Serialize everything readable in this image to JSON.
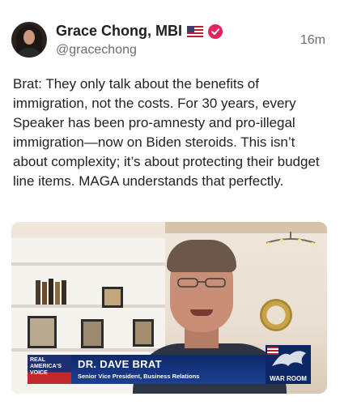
{
  "post": {
    "author_name": "Grace Chong, MBI",
    "handle": "@gracechong",
    "time": "16m",
    "flag_icon": "us-flag-icon",
    "verified_icon": "verified-badge-icon",
    "verified_color": "#e0245e",
    "text": "Brat: They only talk about the benefits of immigration, not the costs. For 30 years, every Speaker has been pro-amnesty and pro-illegal immigration—now on Biden steroids. This isn’t about complexity; it’s about protecting their budget line items. MAGA understands that perfectly."
  },
  "media": {
    "lower_third": {
      "logo_text": "REAL AMERICA'S VOICE",
      "name": "DR. DAVE BRAT",
      "title": "Senior Vice President, Business Relations",
      "brand": "WAR ROOM"
    }
  }
}
